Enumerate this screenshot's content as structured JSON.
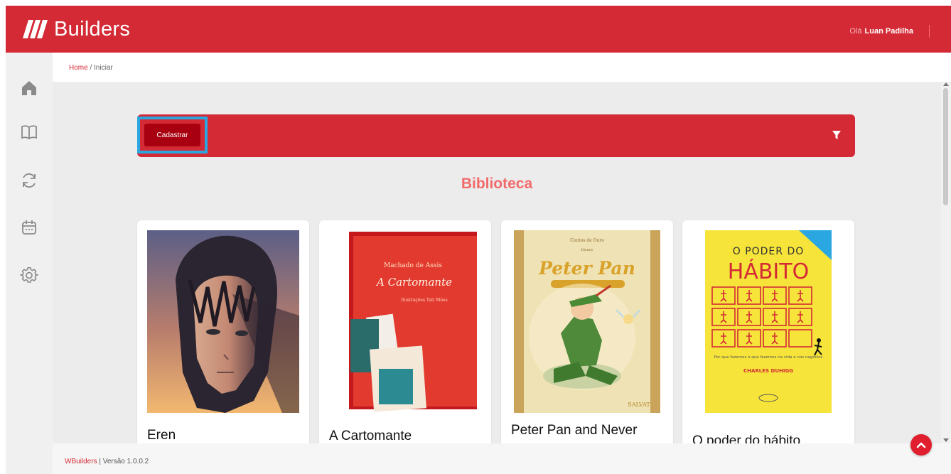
{
  "header": {
    "brand_text": "Builders",
    "greeting_prefix": "Olá",
    "user_name": "Luan Padilha"
  },
  "sidebar": {
    "items": [
      {
        "icon": "home-icon"
      },
      {
        "icon": "book-icon"
      },
      {
        "icon": "refresh-icon"
      },
      {
        "icon": "calendar-icon"
      },
      {
        "icon": "gear-icon"
      }
    ]
  },
  "breadcrumb": {
    "home": "Home",
    "separator": " / ",
    "current": "Iniciar"
  },
  "toolbar": {
    "register_label": "Cadastrar",
    "filter_icon": "filter-icon"
  },
  "library": {
    "title": "Biblioteca",
    "books": [
      {
        "title": "Eren"
      },
      {
        "title": "A Cartomante",
        "cover_text": {
          "author": "Machado de Assis",
          "title": "A Cartomante",
          "credit": "Ilustrações Tati Móes"
        }
      },
      {
        "title": "Peter Pan and Never",
        "cover_text": {
          "series": "Contos de Ouro",
          "brand": "Disney",
          "title": "Peter Pan",
          "publisher": "SALVAT"
        }
      },
      {
        "title": "O poder do hábito",
        "cover_text": {
          "line1": "O PODER DO",
          "line2": "HÁBITO",
          "author": "CHARLES DUHIGG",
          "subtitle": "Por que fazemos o que fazemos na vida e nos negócios"
        }
      }
    ]
  },
  "footer": {
    "brand": "WBuilders",
    "version": " | Versão 1.0.0.2"
  },
  "colors": {
    "primary": "#d42a35",
    "dark_red": "#a80010",
    "highlight": "#2aa7e0",
    "title": "#f26b6b"
  }
}
